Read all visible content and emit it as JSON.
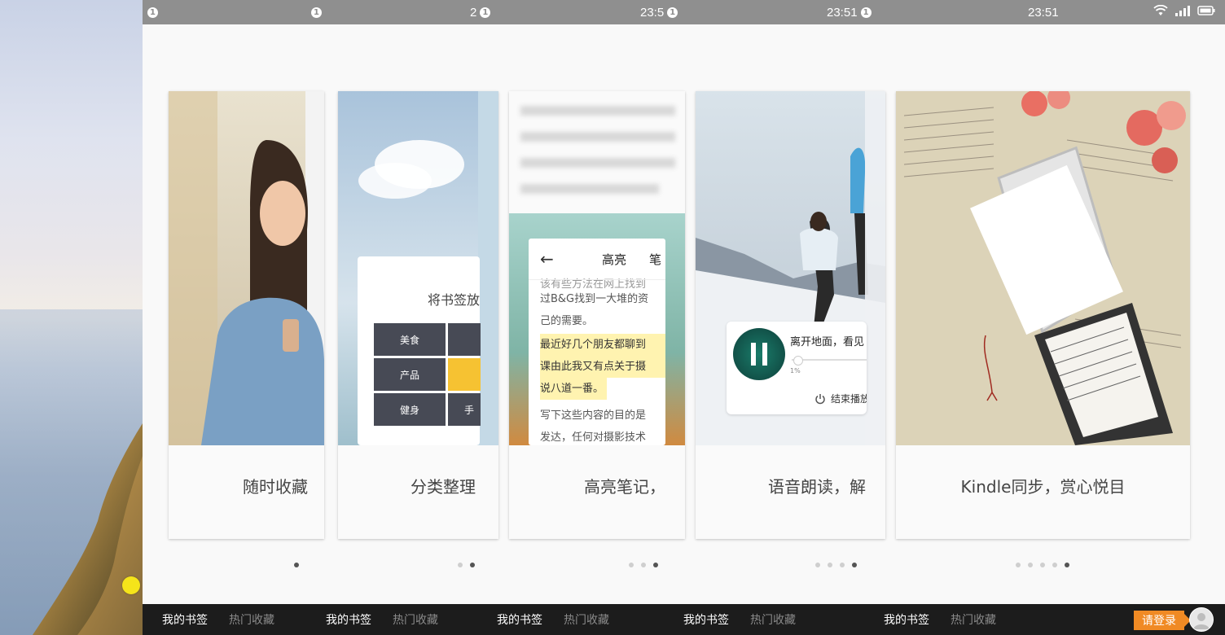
{
  "statusbar": {
    "segments": [
      {
        "time": "",
        "badge": "1"
      },
      {
        "time": "",
        "badge": "1"
      },
      {
        "time": "2",
        "badge": "1"
      },
      {
        "time": "23:5",
        "badge": "1"
      },
      {
        "time": "23:51",
        "badge": "1"
      },
      {
        "time": "23:51",
        "badge": ""
      }
    ]
  },
  "cards": [
    {
      "caption": "随时收藏"
    },
    {
      "caption": "分类整理",
      "dialog_title": "将书签放",
      "tags": [
        "美食",
        "产品",
        "健身",
        "",
        "",
        "手"
      ]
    },
    {
      "caption": "高亮笔记，",
      "toolbar": {
        "back": "←",
        "highlight": "高亮",
        "note": "笔"
      },
      "lines": [
        "该有些方法在网上找到",
        "过B&G找到一大堆的资",
        "己的需要。",
        "最近好几个朋友都聊到",
        "课由此我又有点关于摄",
        "说八道一番。",
        "写下这些内容的目的是",
        "发达，任何对摄影技术"
      ]
    },
    {
      "caption": "语音朗读，解",
      "player": {
        "title": "离开地面，看见",
        "progress": "1%",
        "progress_value": 1,
        "end": "结束播放"
      }
    },
    {
      "caption": "Kindle同步，赏心悦目"
    }
  ],
  "pager": [
    {
      "count": 1,
      "active": 1
    },
    {
      "count": 2,
      "active": 2
    },
    {
      "count": 3,
      "active": 3
    },
    {
      "count": 4,
      "active": 4
    },
    {
      "count": 5,
      "active": 5
    }
  ],
  "bottom_nav": [
    {
      "my": "我的书签",
      "hot": "热门收藏"
    },
    {
      "my": "我的书签",
      "hot": "热门收藏"
    },
    {
      "my": "我的书签",
      "hot": "热门收藏"
    },
    {
      "my": "我的书签",
      "hot": "热门收藏"
    },
    {
      "my": "我的书签",
      "hot": "热门收藏"
    }
  ],
  "login_label": "请登录",
  "colors": {
    "accent": "#f08a24",
    "statusbar": "#8f8f8f",
    "bottombar": "#1c1c1c",
    "highlight": "#fff3b0",
    "tag_dark": "#474a55",
    "tag_yellow": "#f6c232"
  }
}
